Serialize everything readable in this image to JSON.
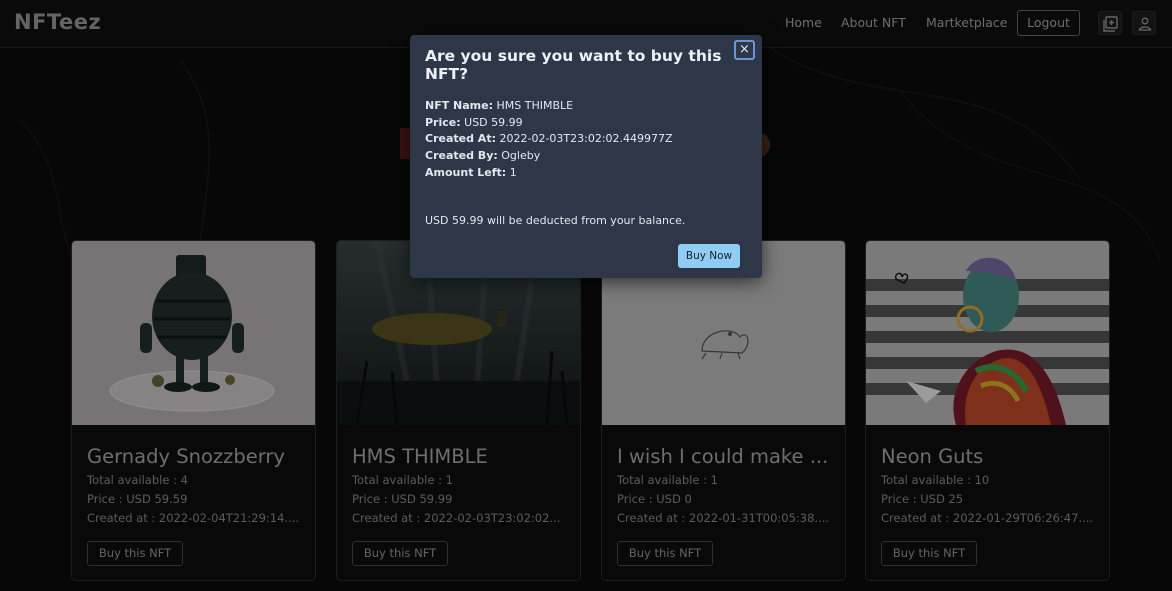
{
  "navbar": {
    "brand": "NFTeez",
    "links": [
      "Home",
      "About NFT",
      "Martketplace"
    ],
    "logout_label": "Logout",
    "icons": [
      "add-box-icon",
      "user-icon"
    ]
  },
  "cards": [
    {
      "title": "Gernady Snozzberry",
      "total_label": "Total available :",
      "total": "4",
      "price_label": "Price :",
      "price": "USD 59.59",
      "created_label": "Created at :",
      "created": "2022-02-04T21:29:14....",
      "button": "Buy this NFT"
    },
    {
      "title": "HMS THIMBLE",
      "total_label": "Total available :",
      "total": "1",
      "price_label": "Price :",
      "price": "USD 59.99",
      "created_label": "Created at :",
      "created": "2022-02-03T23:02:02...",
      "button": "Buy this NFT"
    },
    {
      "title": "I wish I could make ...",
      "total_label": "Total available :",
      "total": "1",
      "price_label": "Price :",
      "price": "USD 0",
      "created_label": "Created at :",
      "created": "2022-01-31T00:05:38....",
      "button": "Buy this NFT"
    },
    {
      "title": "Neon Guts",
      "total_label": "Total available :",
      "total": "10",
      "price_label": "Price :",
      "price": "USD 25",
      "created_label": "Created at :",
      "created": "2022-01-29T06:26:47....",
      "button": "Buy this NFT"
    }
  ],
  "modal": {
    "title": "Are you sure you want to buy this NFT?",
    "close_label": "×",
    "name_label": "NFT Name:",
    "name": "HMS THIMBLE",
    "price_label": "Price:",
    "price": "USD 59.99",
    "created_label": "Created At:",
    "created": "2022-02-03T23:02:02.449977Z",
    "by_label": "Created By:",
    "by": "Ogleby",
    "left_label": "Amount Left:",
    "left": "1",
    "note": "USD 59.99 will be deducted from your balance.",
    "buy_label": "Buy Now"
  },
  "colors": {
    "modal_bg": "#2d3748",
    "buy_now_bg": "#90cdf4",
    "close_border": "#6c95d6"
  }
}
